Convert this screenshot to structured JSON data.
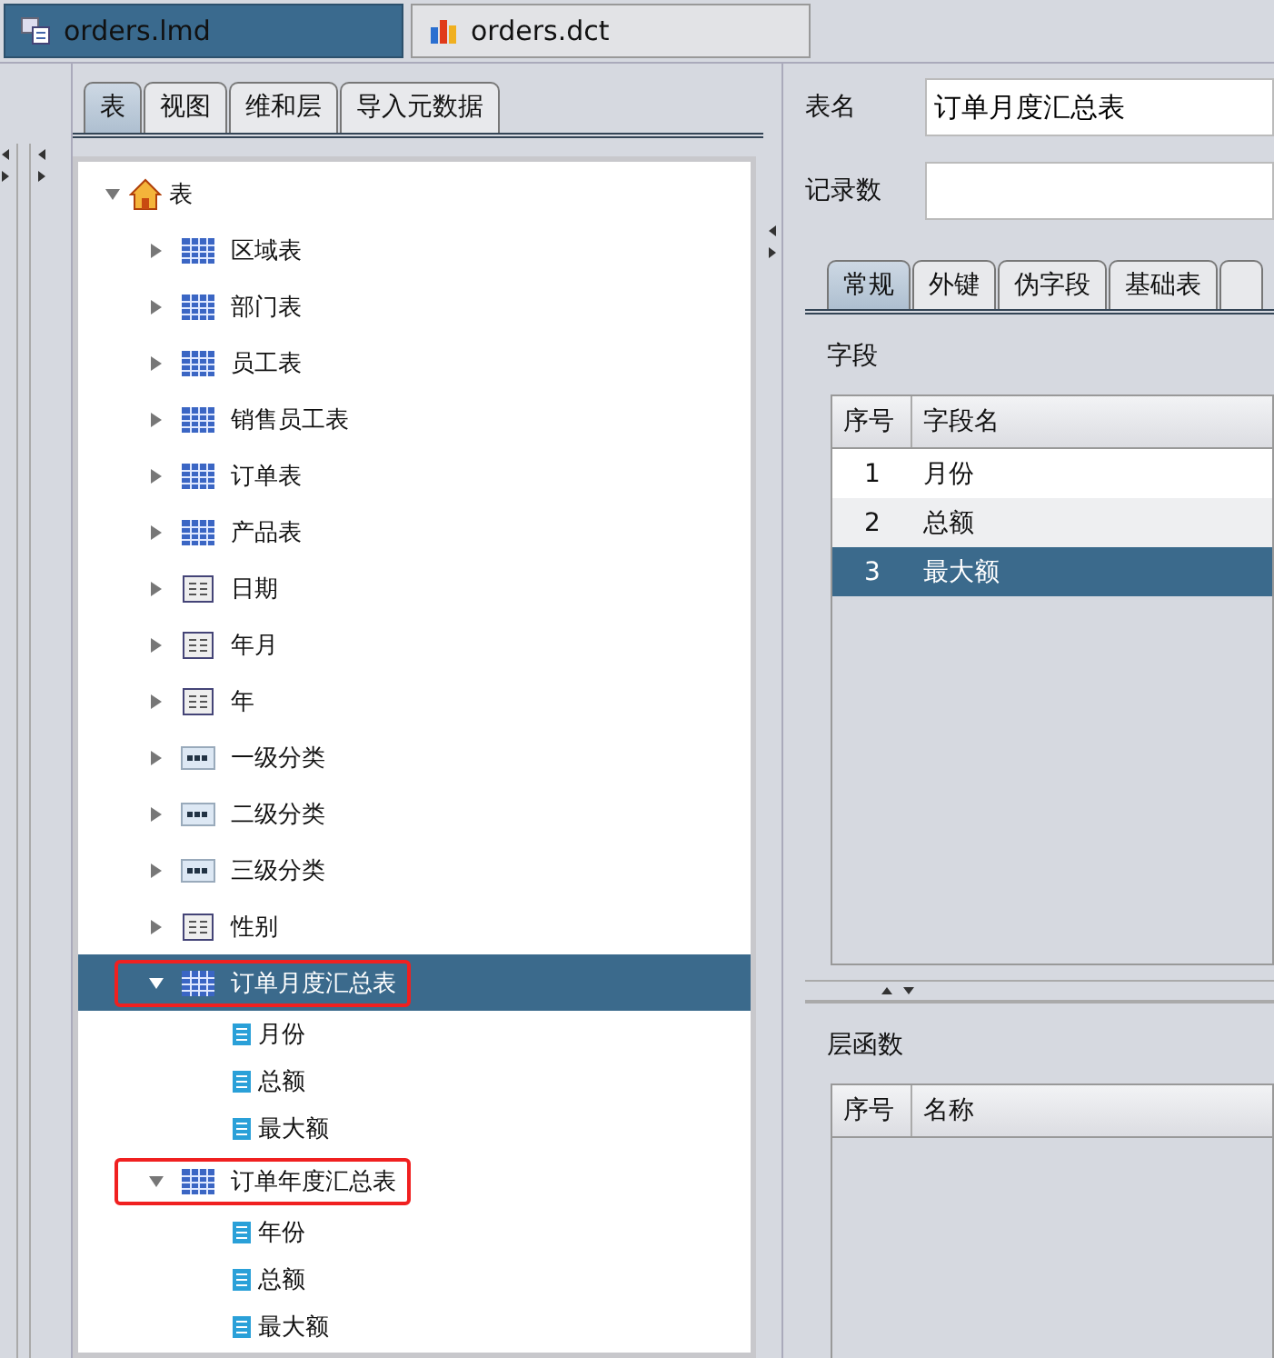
{
  "doc_tabs": [
    {
      "label": "orders.lmd",
      "kind": "model",
      "selected": true
    },
    {
      "label": "orders.dct",
      "kind": "chart",
      "selected": false
    }
  ],
  "left_tabs": [
    {
      "label": "表",
      "selected": true
    },
    {
      "label": "视图",
      "selected": false
    },
    {
      "label": "维和层",
      "selected": false
    },
    {
      "label": "导入元数据",
      "selected": false
    }
  ],
  "tree": {
    "label": "表",
    "kind": "home",
    "expanded": true,
    "selected": false,
    "highlighted": false,
    "children": [
      {
        "label": "区域表",
        "kind": "table",
        "expanded": false,
        "selected": false,
        "highlighted": false
      },
      {
        "label": "部门表",
        "kind": "table",
        "expanded": false,
        "selected": false,
        "highlighted": false
      },
      {
        "label": "员工表",
        "kind": "table",
        "expanded": false,
        "selected": false,
        "highlighted": false
      },
      {
        "label": "销售员工表",
        "kind": "table",
        "expanded": false,
        "selected": false,
        "highlighted": false
      },
      {
        "label": "订单表",
        "kind": "table",
        "expanded": false,
        "selected": false,
        "highlighted": false
      },
      {
        "label": "产品表",
        "kind": "table",
        "expanded": false,
        "selected": false,
        "highlighted": false
      },
      {
        "label": "日期",
        "kind": "view",
        "expanded": false,
        "selected": false,
        "highlighted": false
      },
      {
        "label": "年月",
        "kind": "view",
        "expanded": false,
        "selected": false,
        "highlighted": false
      },
      {
        "label": "年",
        "kind": "view",
        "expanded": false,
        "selected": false,
        "highlighted": false
      },
      {
        "label": "一级分类",
        "kind": "sql",
        "expanded": false,
        "selected": false,
        "highlighted": false
      },
      {
        "label": "二级分类",
        "kind": "sql",
        "expanded": false,
        "selected": false,
        "highlighted": false
      },
      {
        "label": "三级分类",
        "kind": "sql",
        "expanded": false,
        "selected": false,
        "highlighted": false
      },
      {
        "label": "性别",
        "kind": "view",
        "expanded": false,
        "selected": false,
        "highlighted": false
      },
      {
        "label": "订单月度汇总表",
        "kind": "table",
        "expanded": true,
        "selected": true,
        "highlighted": true,
        "children": [
          {
            "label": "月份",
            "kind": "field",
            "selected": false,
            "highlighted": false
          },
          {
            "label": "总额",
            "kind": "field",
            "selected": false,
            "highlighted": false
          },
          {
            "label": "最大额",
            "kind": "field",
            "selected": false,
            "highlighted": false
          }
        ]
      },
      {
        "label": "订单年度汇总表",
        "kind": "table",
        "expanded": true,
        "selected": false,
        "highlighted": true,
        "children": [
          {
            "label": "年份",
            "kind": "field",
            "selected": false,
            "highlighted": false
          },
          {
            "label": "总额",
            "kind": "field",
            "selected": false,
            "highlighted": false
          },
          {
            "label": "最大额",
            "kind": "field",
            "selected": false,
            "highlighted": false
          }
        ]
      }
    ]
  },
  "form": {
    "name_label": "表名",
    "name_value": "订单月度汇总表",
    "count_label": "记录数"
  },
  "detail_tabs": [
    {
      "label": "常规",
      "selected": true
    },
    {
      "label": "外键",
      "selected": false
    },
    {
      "label": "伪字段",
      "selected": false
    },
    {
      "label": "基础表",
      "selected": false
    }
  ],
  "fields_section": {
    "title": "字段",
    "columns": [
      "序号",
      "字段名"
    ],
    "rows": [
      {
        "cells": [
          "1",
          "月份"
        ],
        "selected": false
      },
      {
        "cells": [
          "2",
          "总额"
        ],
        "selected": false
      },
      {
        "cells": [
          "3",
          "最大额"
        ],
        "selected": true
      }
    ]
  },
  "functions_section": {
    "title": "层函数",
    "columns": [
      "序号",
      "名称"
    ]
  }
}
